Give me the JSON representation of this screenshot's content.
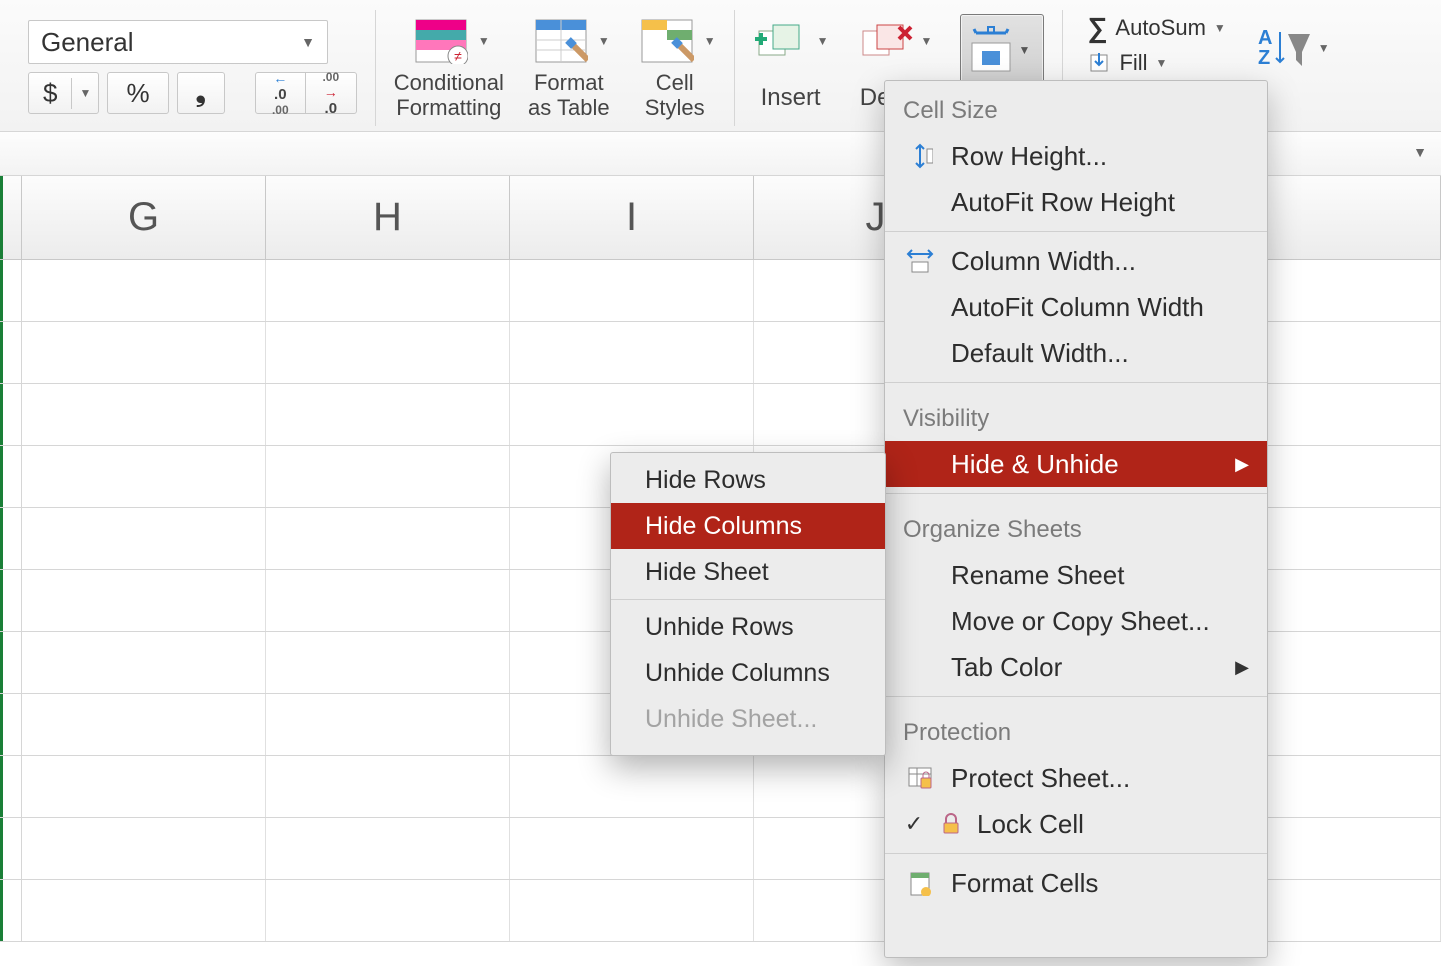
{
  "ribbon": {
    "number_format": "General",
    "currency": "$",
    "percent": "%",
    "comma": "❯",
    "inc_dec": ".0",
    "dec_dec": ".00",
    "conditional": "Conditional\nFormatting",
    "format_table": "Format\nas Table",
    "cell_styles": "Cell\nStyles",
    "insert": "Insert",
    "delete": "Delete",
    "autosum": "AutoSum",
    "fill": "Fill",
    "sort_filter": "Sort &\nFilter"
  },
  "columns": [
    "G",
    "H",
    "I",
    "J"
  ],
  "format_panel": {
    "sections": {
      "cell_size": "Cell Size",
      "visibility": "Visibility",
      "organize": "Organize Sheets",
      "protection": "Protection"
    },
    "items": {
      "row_height": "Row Height...",
      "autofit_row": "AutoFit Row Height",
      "col_width": "Column Width...",
      "autofit_col": "AutoFit Column Width",
      "default_width": "Default Width...",
      "hide_unhide": "Hide & Unhide",
      "rename_sheet": "Rename Sheet",
      "move_copy": "Move or Copy Sheet...",
      "tab_color": "Tab Color",
      "protect_sheet": "Protect Sheet...",
      "lock_cell": "Lock Cell",
      "format_cells": "Format Cells"
    }
  },
  "submenu": {
    "hide_rows": "Hide Rows",
    "hide_columns": "Hide Columns",
    "hide_sheet": "Hide Sheet",
    "unhide_rows": "Unhide Rows",
    "unhide_columns": "Unhide Columns",
    "unhide_sheet": "Unhide Sheet..."
  }
}
